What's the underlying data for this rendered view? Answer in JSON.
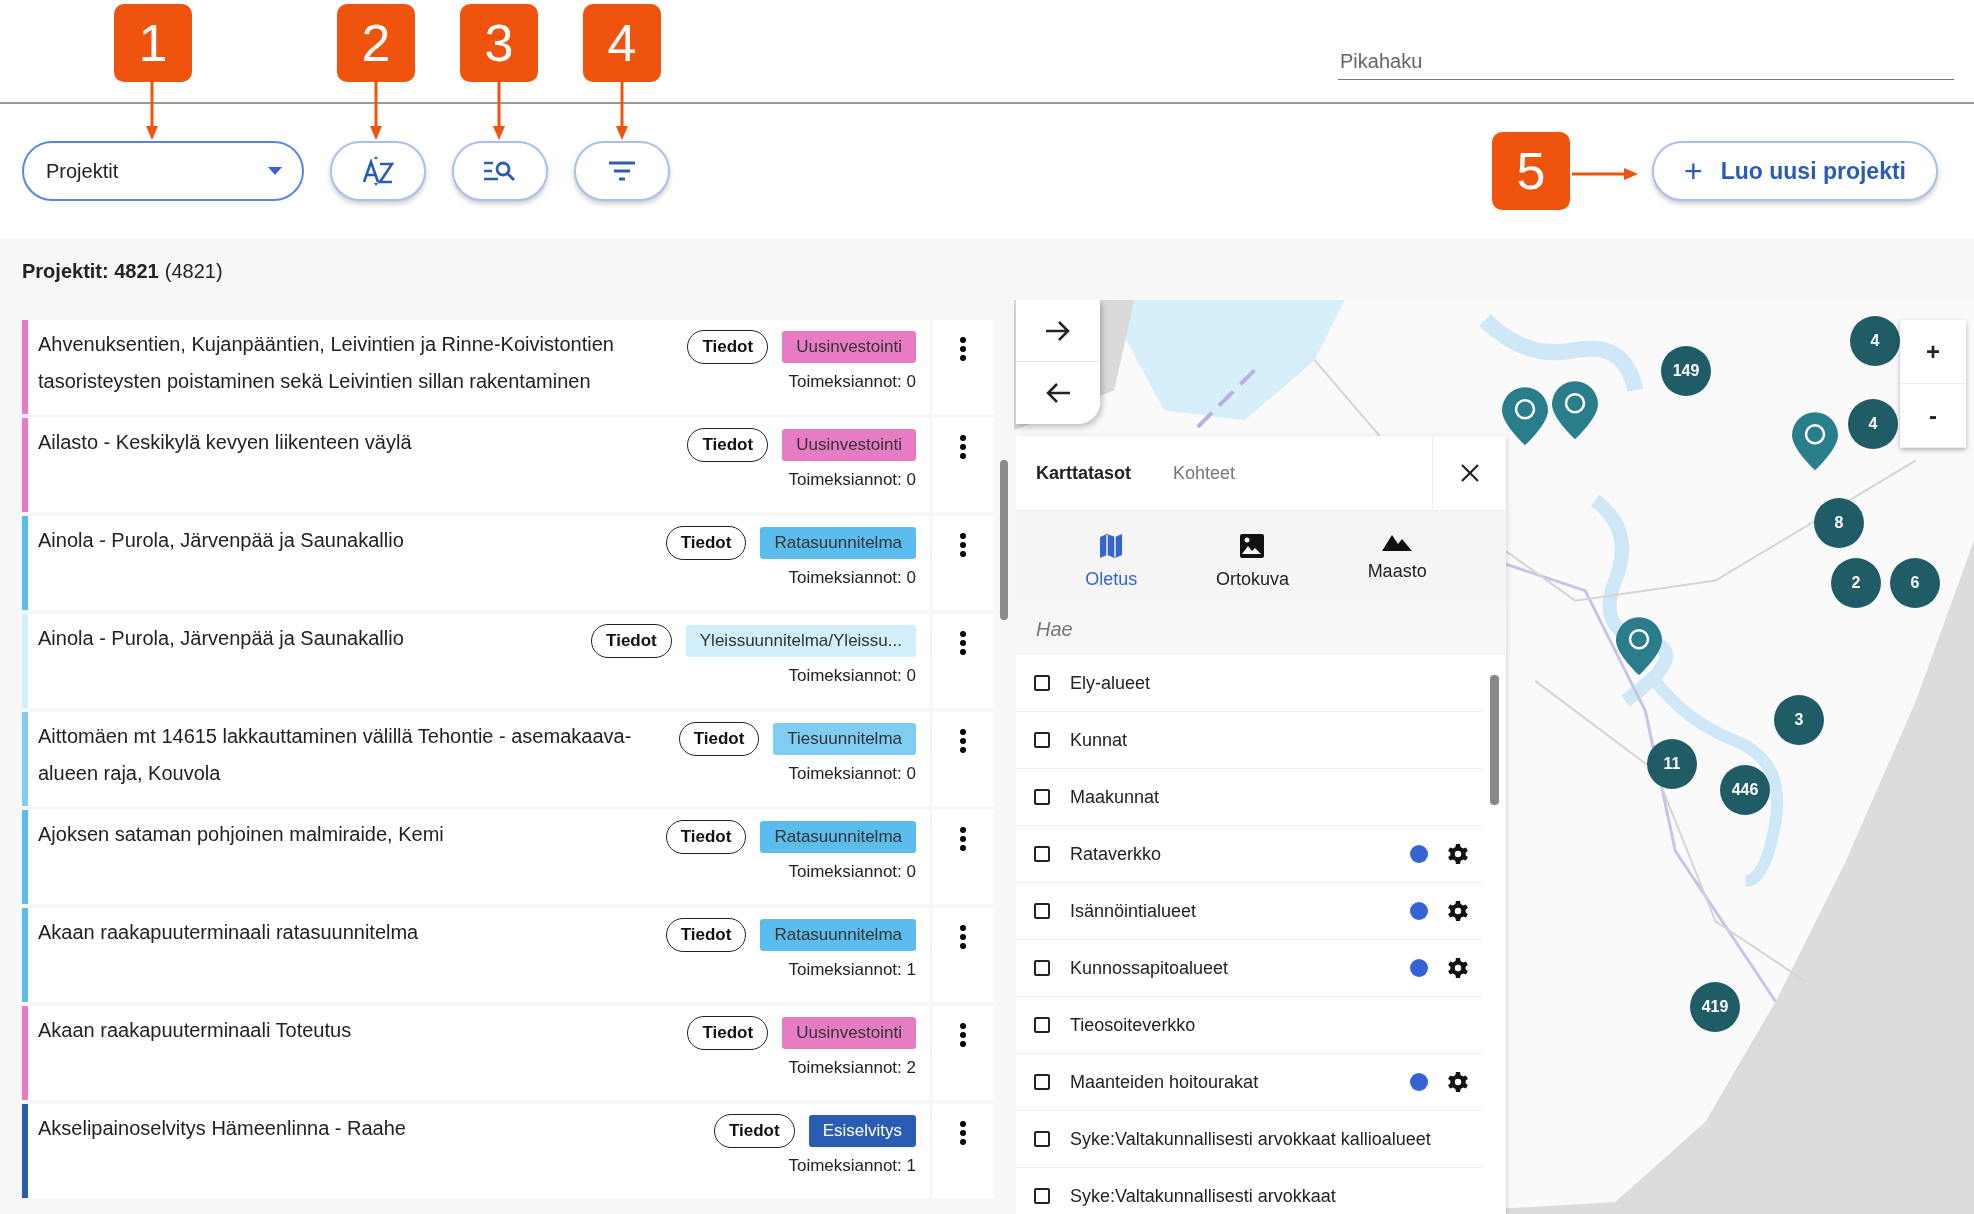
{
  "callouts": [
    {
      "label": "1"
    },
    {
      "label": "2"
    },
    {
      "label": "3"
    },
    {
      "label": "4"
    },
    {
      "label": "5"
    }
  ],
  "quick_search": {
    "placeholder": "Pikahaku"
  },
  "toolbar": {
    "dropdown": {
      "value": "Projektit"
    },
    "new_button": {
      "icon": "+",
      "label": "Luo uusi projekti"
    }
  },
  "summary": {
    "label": "Projektit: 4821",
    "count": "(4821)"
  },
  "projects": [
    {
      "title": "Ahvenuksentien, Kujanpääntien, Leivintien ja Rinne-Koivistontien tasoristeysten poistaminen sekä Leivintien sillan rakentaminen",
      "info": "Tiedot",
      "tag": "Uusinvestointi",
      "color": "#e87cc4",
      "assignments": "Toimeksiannot: 0"
    },
    {
      "title": "Ailasto - Keskikylä kevyen liikenteen väylä",
      "info": "Tiedot",
      "tag": "Uusinvestointi",
      "color": "#e87cc4",
      "assignments": "Toimeksiannot: 0"
    },
    {
      "title": "Ainola - Purola, Järvenpää ja Saunakallio",
      "info": "Tiedot",
      "tag": "Ratasuunnitelma",
      "color": "#5bbcee",
      "assignments": "Toimeksiannot: 0"
    },
    {
      "title": "Ainola - Purola, Järvenpää ja Saunakallio",
      "info": "Tiedot",
      "tag": "Yleissuunnitelma/Yleissu...",
      "color": "#d2effb",
      "assignments": "Toimeksiannot: 0"
    },
    {
      "title": "Aittomäen mt 14615 lakkauttaminen välillä Tehontie - asemakaava-alueen raja, Kouvola",
      "info": "Tiedot",
      "tag": "Tiesuunnitelma",
      "color": "#7fcdf2",
      "assignments": "Toimeksiannot: 0"
    },
    {
      "title": "Ajoksen sataman pohjoinen malmiraide, Kemi",
      "info": "Tiedot",
      "tag": "Ratasuunnitelma",
      "color": "#5bbcee",
      "assignments": "Toimeksiannot: 0"
    },
    {
      "title": "Akaan raakapuuterminaali ratasuunnitelma",
      "info": "Tiedot",
      "tag": "Ratasuunnitelma",
      "color": "#5bbcee",
      "assignments": "Toimeksiannot: 1"
    },
    {
      "title": "Akaan raakapuuterminaali Toteutus",
      "info": "Tiedot",
      "tag": "Uusinvestointi",
      "color": "#e87cc4",
      "assignments": "Toimeksiannot: 2"
    },
    {
      "title": "Akselipainoselvitys Hämeenlinna - Raahe",
      "info": "Tiedot",
      "tag": "Esiselvitys",
      "color": "#2b5cb3",
      "assignments": "Toimeksiannot: 1"
    }
  ],
  "map": {
    "kind": "picture",
    "clusters": [
      {
        "count": "4"
      },
      {
        "count": "149"
      },
      {
        "count": "4"
      },
      {
        "count": "8"
      },
      {
        "count": "2"
      },
      {
        "count": "6"
      },
      {
        "count": "3"
      },
      {
        "count": "11"
      },
      {
        "count": "446"
      },
      {
        "count": "419"
      }
    ],
    "zoom": {
      "in": "+",
      "out": "-"
    },
    "layer_panel": {
      "tabs": [
        {
          "label": "Karttatasot",
          "selected": true
        },
        {
          "label": "Kohteet",
          "selected": false
        }
      ],
      "basemaps": [
        {
          "kind": "map",
          "label": "Oletus",
          "selected": true
        },
        {
          "label": "Ortokuva",
          "selected": false
        },
        {
          "kind": "terrain",
          "label": "Maasto",
          "selected": false
        }
      ],
      "search": {
        "placeholder": "Hae"
      },
      "layers": [
        {
          "label": "Ely-alueet",
          "checked": false,
          "settings": false
        },
        {
          "label": "Kunnat",
          "checked": false,
          "settings": false
        },
        {
          "label": "Maakunnat",
          "checked": false,
          "settings": false
        },
        {
          "label": "Rataverkko",
          "checked": false,
          "color": "#3563d3",
          "settings": true
        },
        {
          "label": "Isännöintialueet",
          "checked": false,
          "color": "#3563d3",
          "settings": true
        },
        {
          "label": "Kunnossapitoalueet",
          "checked": false,
          "color": "#3563d3",
          "settings": true
        },
        {
          "label": "Tieosoiteverkko",
          "checked": false,
          "settings": false
        },
        {
          "label": "Maanteiden hoitourakat",
          "checked": false,
          "color": "#3563d3",
          "settings": true
        },
        {
          "label": "Syke:Valtakunnallisesti arvokkaat kallioalueet",
          "checked": false,
          "settings": false
        },
        {
          "label": "Syke:Valtakunnallisesti arvokkaat",
          "checked": false,
          "settings": false
        }
      ]
    }
  }
}
